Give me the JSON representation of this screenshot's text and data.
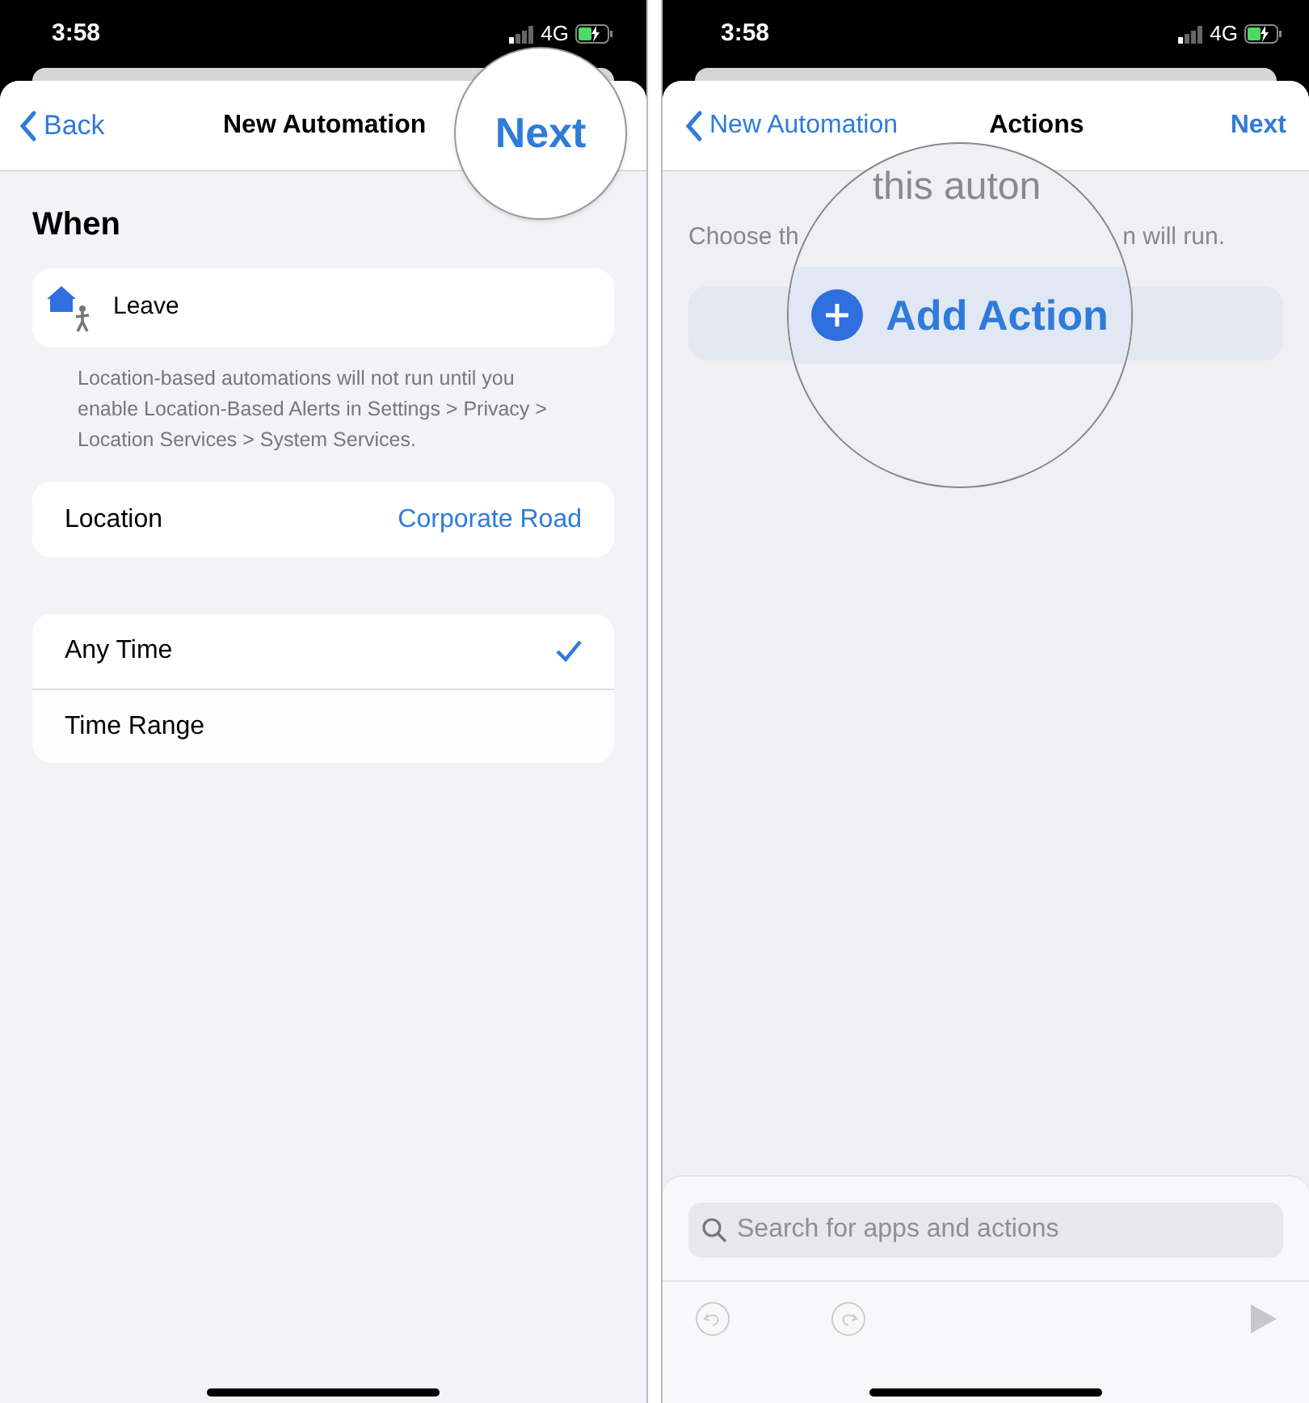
{
  "left_screen": {
    "status_bar": {
      "time": "3:58",
      "network": "4G"
    },
    "nav_bar": {
      "back": "Back",
      "title": "New Automation",
      "next": "Next"
    },
    "section_title": "When",
    "trigger": {
      "label": "Leave"
    },
    "footnote": "Location-based automations will not run until you enable Location-Based Alerts in Settings > Privacy > Location Services > System Services.",
    "location": {
      "label": "Location",
      "value": "Corporate Road"
    },
    "time_options": [
      {
        "label": "Any Time",
        "selected": true
      },
      {
        "label": "Time Range",
        "selected": false
      }
    ]
  },
  "right_screen": {
    "status_bar": {
      "time": "3:58",
      "network": "4G"
    },
    "nav_bar": {
      "back": "New Automation",
      "title": "Actions",
      "next": "Next"
    },
    "heading_fragment": "this auton",
    "description_fragments": [
      "Choose th",
      "n will run."
    ],
    "add_action": "Add Action",
    "search": {
      "placeholder": "Search for apps and actions"
    }
  }
}
